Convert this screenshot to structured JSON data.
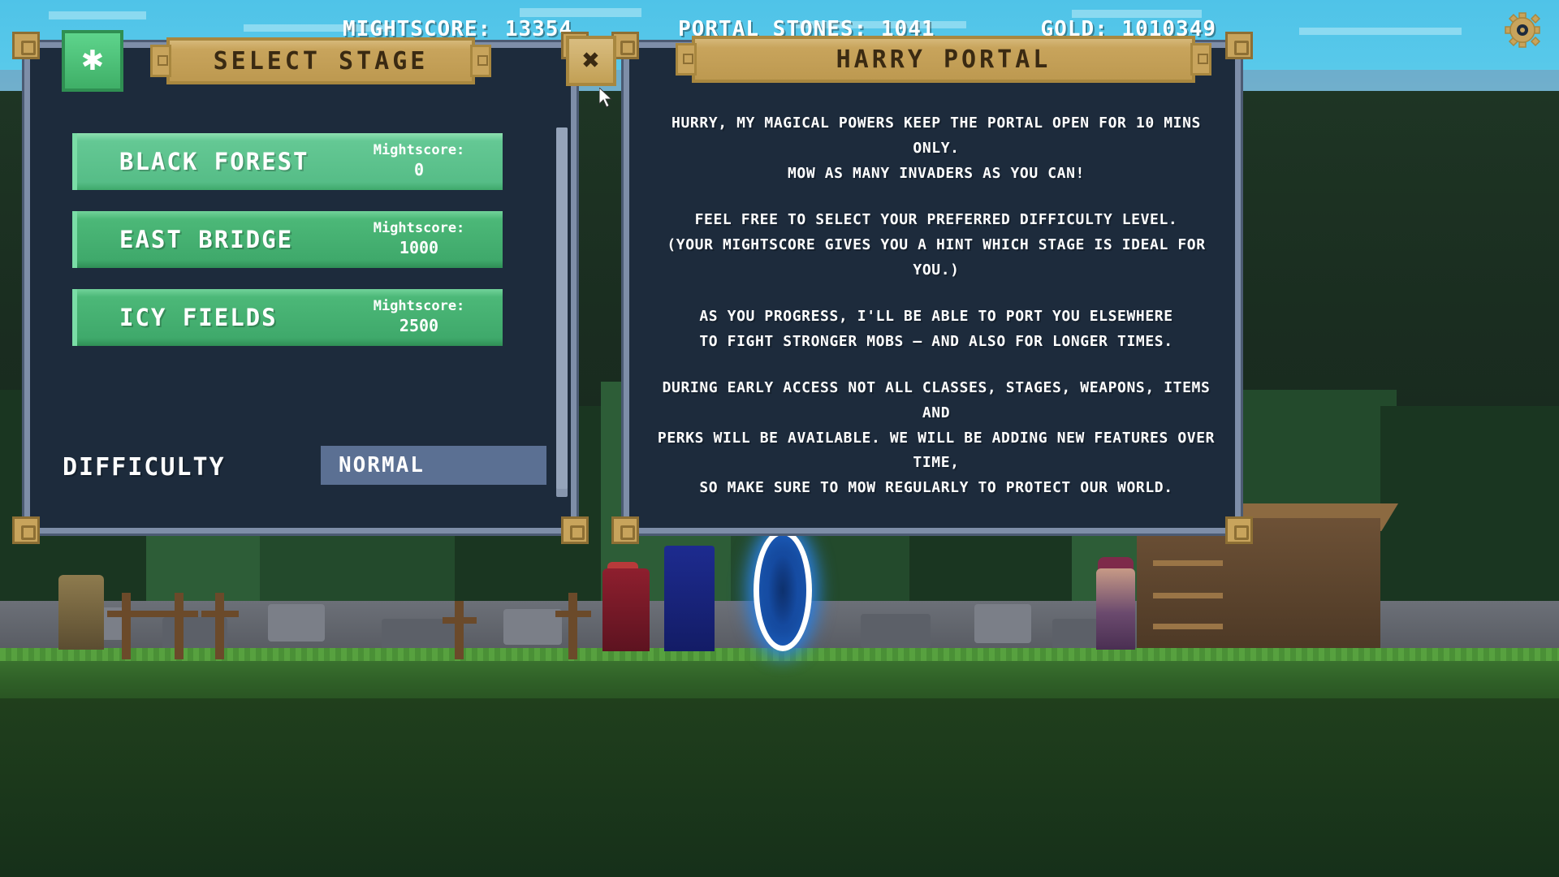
{
  "hud": {
    "mightscore_label": "MIGHTSCORE:",
    "mightscore_value": "13354",
    "mightscore_text": "MIGHTSCORE: 13354",
    "portal_stones_text": "PORTAL STONES: 1041",
    "gold_text": "GOLD: 1010349",
    "settings_icon": "gear-icon"
  },
  "left_panel": {
    "title": "SELECT STAGE",
    "star_button_icon": "star-icon",
    "close_button_icon": "close-x-icon",
    "stages": [
      {
        "name": "BLACK FOREST",
        "score_label": "Mightscore:",
        "score_value": "0",
        "hovered": true
      },
      {
        "name": "EAST BRIDGE",
        "score_label": "Mightscore:",
        "score_value": "1000",
        "hovered": false
      },
      {
        "name": "ICY FIELDS",
        "score_label": "Mightscore:",
        "score_value": "2500",
        "hovered": false
      }
    ],
    "difficulty_label": "DIFFICULTY",
    "difficulty_value": "NORMAL"
  },
  "right_panel": {
    "title": "HARRY PORTAL",
    "paragraphs": [
      [
        "HURRY, MY MAGICAL POWERS KEEP THE PORTAL OPEN FOR 10 MINS ONLY.",
        "MOW AS MANY INVADERS AS YOU CAN!"
      ],
      [
        "FEEL FREE TO SELECT YOUR PREFERRED DIFFICULTY LEVEL.",
        "(YOUR MIGHTSCORE GIVES YOU A HINT WHICH STAGE IS IDEAL FOR YOU.)"
      ],
      [
        "AS YOU PROGRESS, I'LL BE ABLE TO PORT YOU ELSEWHERE",
        "TO FIGHT STRONGER MOBS — AND ALSO FOR LONGER TIMES."
      ],
      [
        "DURING EARLY ACCESS NOT ALL CLASSES, STAGES, WEAPONS, ITEMS AND",
        "PERKS WILL BE AVAILABLE. WE WILL BE ADDING NEW FEATURES OVER TIME,",
        "SO MAKE SURE TO MOW REGULARLY TO PROTECT OUR WORLD."
      ]
    ]
  },
  "colors": {
    "panel_bg": "#1d2b3c",
    "panel_border": "#7e8ea8",
    "plaque": "#c8a45c",
    "stage_green": "#3fa96b",
    "stage_green_hover": "#56bd87",
    "dropdown_blue": "#5b7093",
    "text_white": "#ffffff"
  }
}
